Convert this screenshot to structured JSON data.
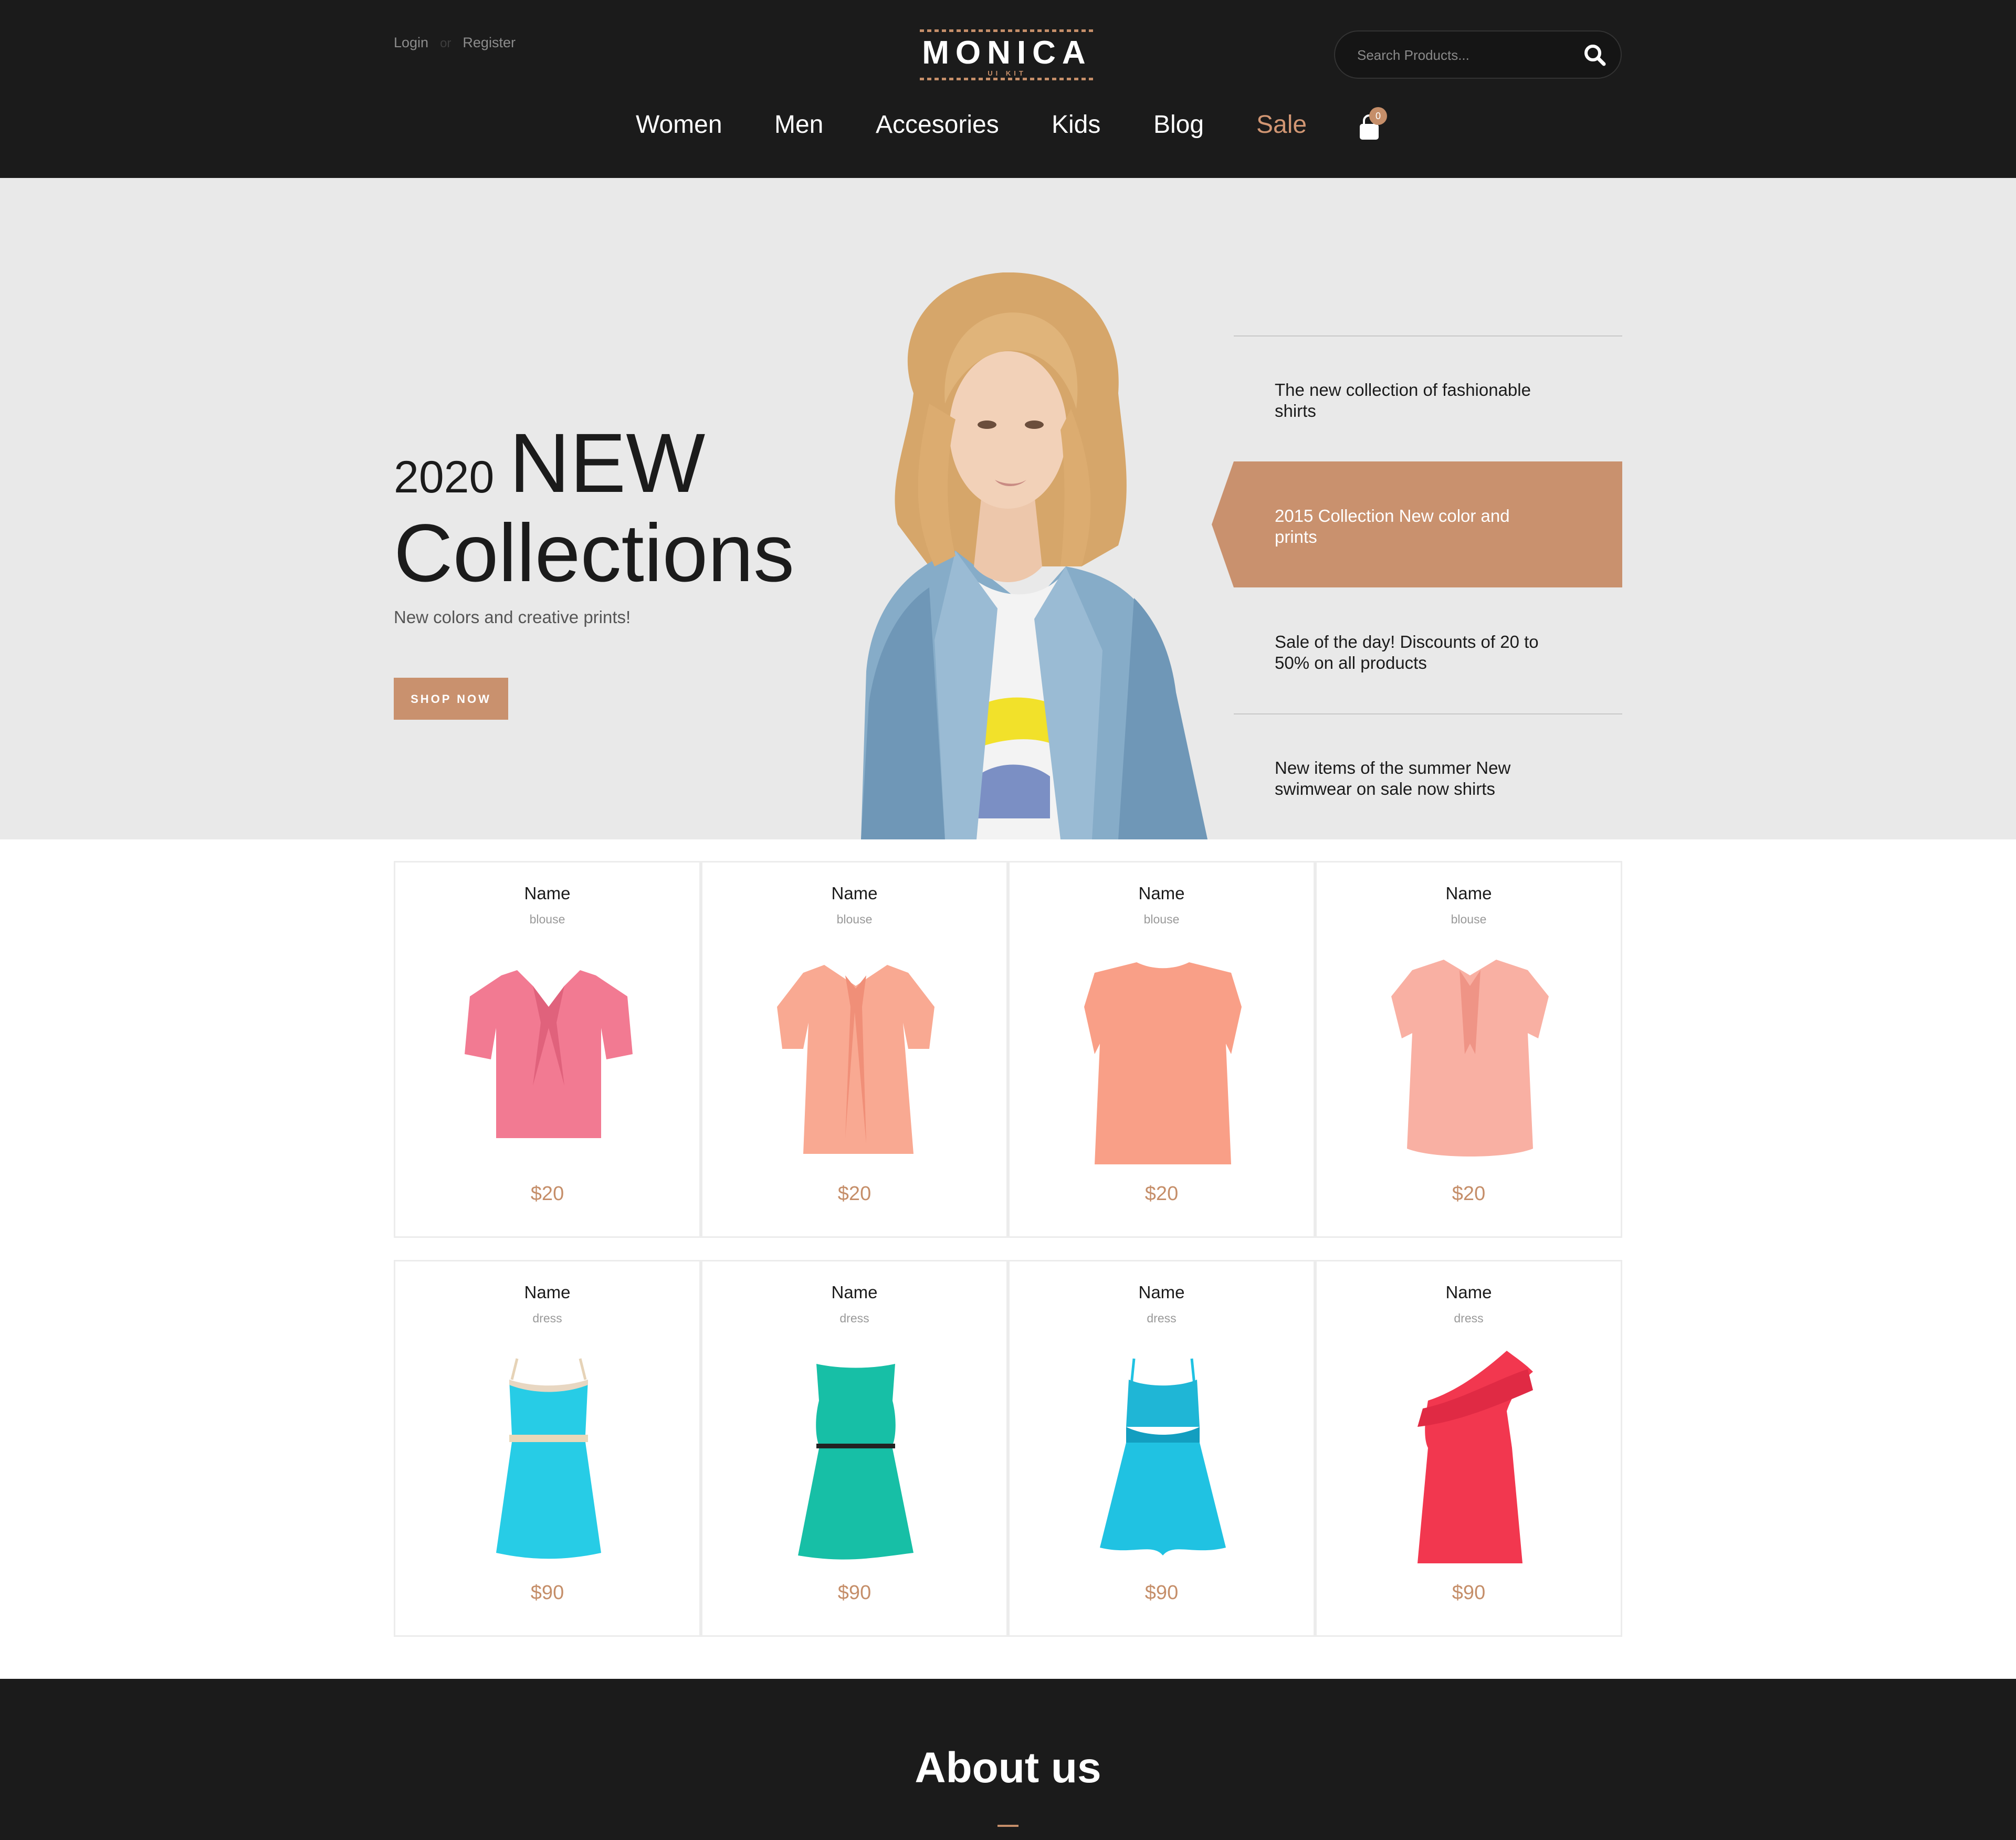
{
  "header": {
    "login": "Login",
    "separator": "or",
    "register": "Register",
    "logo": "MONICA",
    "logo_sub": "UI KIT",
    "search_placeholder": "Search Products...",
    "nav": [
      "Women",
      "Men",
      "Accesories",
      "Kids",
      "Blog",
      "Sale"
    ],
    "cart_count": "0"
  },
  "hero": {
    "year": "2020",
    "headline_word": "NEW",
    "headline_line2": "Collections",
    "tagline": "New colors and creative prints!",
    "cta": "SHOP NOW",
    "slides": [
      "The new collection of fashionable shirts",
      "2015 Collection New color and prints",
      "Sale of the day! Discounts of 20 to 50% on all products",
      "New items of the summer New swimwear on sale now shirts"
    ],
    "active_slide": 1
  },
  "products": [
    {
      "name": "Name",
      "category": "blouse",
      "price": "$20"
    },
    {
      "name": "Name",
      "category": "blouse",
      "price": "$20"
    },
    {
      "name": "Name",
      "category": "blouse",
      "price": "$20"
    },
    {
      "name": "Name",
      "category": "blouse",
      "price": "$20"
    },
    {
      "name": "Name",
      "category": "dress",
      "price": "$90"
    },
    {
      "name": "Name",
      "category": "dress",
      "price": "$90"
    },
    {
      "name": "Name",
      "category": "dress",
      "price": "$90"
    },
    {
      "name": "Name",
      "category": "dress",
      "price": "$90"
    }
  ],
  "about": {
    "title": "About us"
  },
  "colors": {
    "dark": "#1b1b1b",
    "accent": "#c58e69",
    "hero_bg": "#e9e9e9",
    "product_colors": [
      "#f27a92",
      "#f9a992",
      "#f99f87",
      "#f9b0a3",
      "#27cce6",
      "#17bfa6",
      "#20c2e2",
      "#f2374f"
    ]
  }
}
